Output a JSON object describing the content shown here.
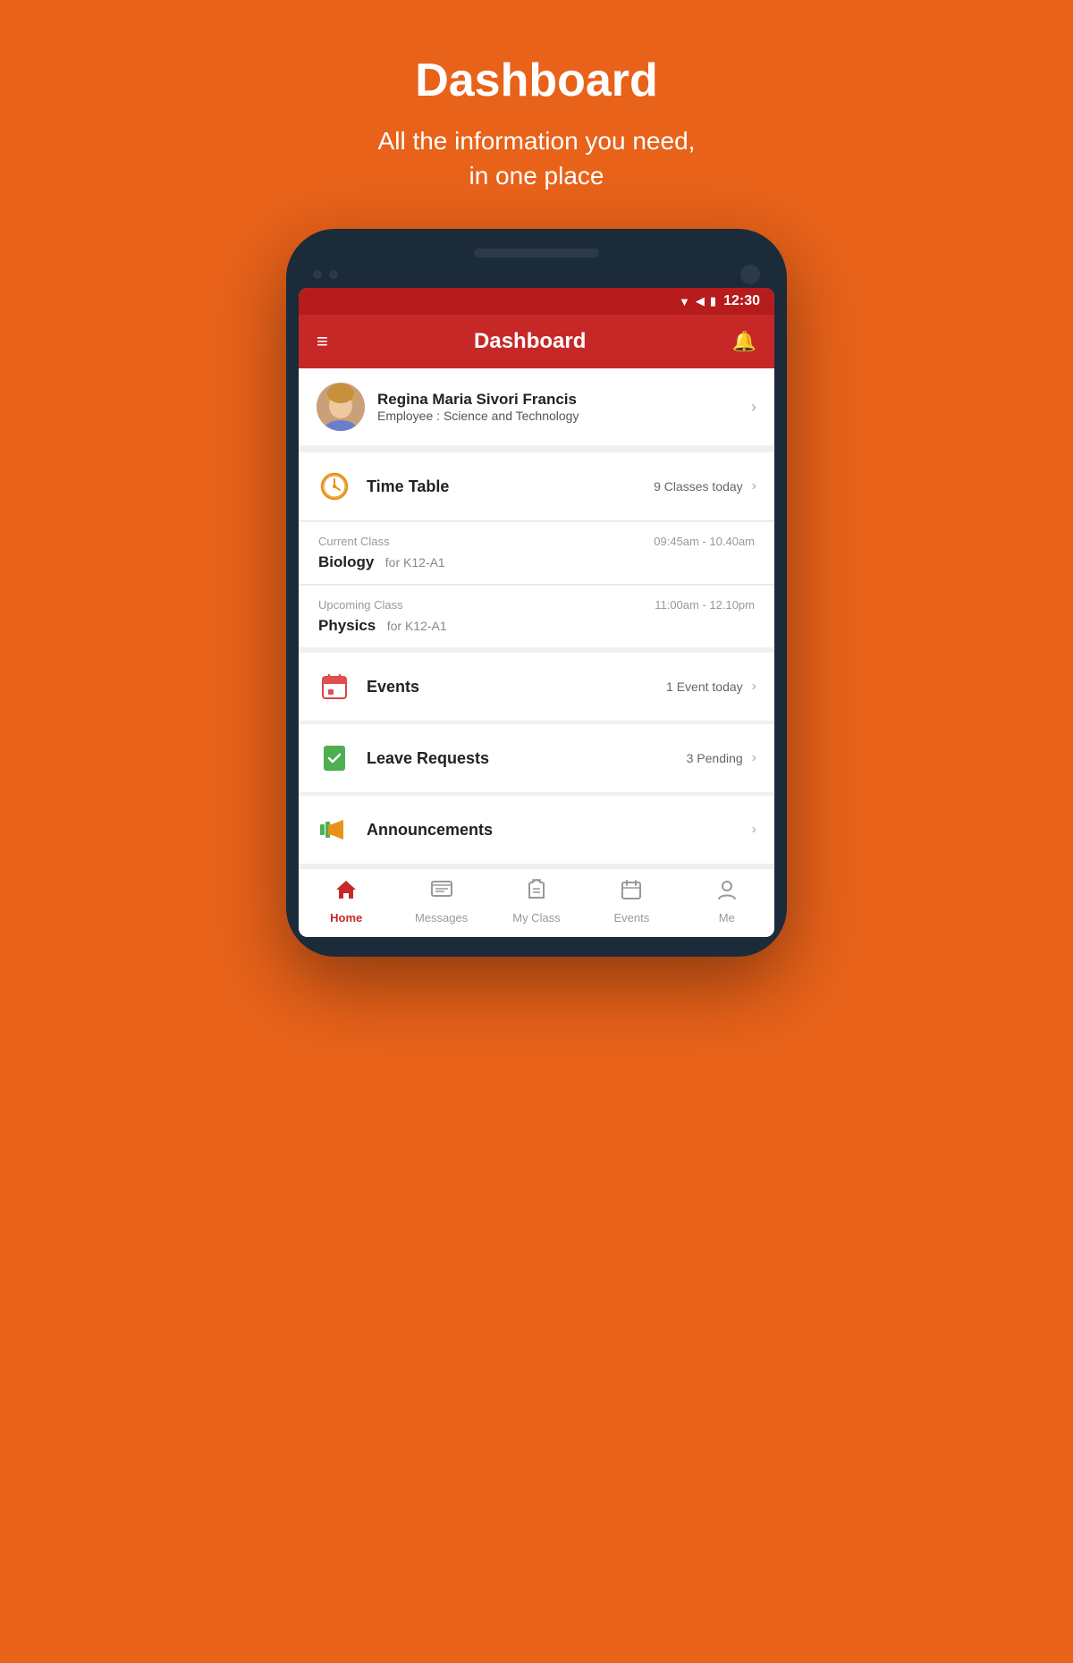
{
  "page": {
    "title": "Dashboard",
    "subtitle_line1": "All the information you need,",
    "subtitle_line2": "in one place"
  },
  "status_bar": {
    "time": "12:30",
    "wifi": "▲",
    "signal": "▲",
    "battery": "▮"
  },
  "app_bar": {
    "title": "Dashboard",
    "menu_icon": "≡",
    "bell_icon": "🔔"
  },
  "profile": {
    "name": "Regina Maria Sivori Francis",
    "role_label": "Employee : ",
    "role_value": "Science and Technology",
    "avatar_emoji": "👩"
  },
  "timetable": {
    "label": "Time Table",
    "badge": "9 Classes today",
    "icon": "⏰",
    "current_class": {
      "type": "Current Class",
      "time": "09:45am - 10.40am",
      "name": "Biology",
      "group": "for K12-A1"
    },
    "upcoming_class": {
      "type": "Upcoming Class",
      "time": "11:00am - 12.10pm",
      "name": "Physics",
      "group": "for K12-A1"
    }
  },
  "events": {
    "label": "Events",
    "badge": "1 Event today",
    "icon": "📅"
  },
  "leave_requests": {
    "label": "Leave Requests",
    "badge": "3 Pending",
    "icon": "✅"
  },
  "announcements": {
    "label": "Announcements",
    "badge": "",
    "icon": "📢"
  },
  "bottom_nav": {
    "home": "Home",
    "messages": "Messages",
    "my_class": "My Class",
    "events": "Events",
    "me": "Me"
  }
}
